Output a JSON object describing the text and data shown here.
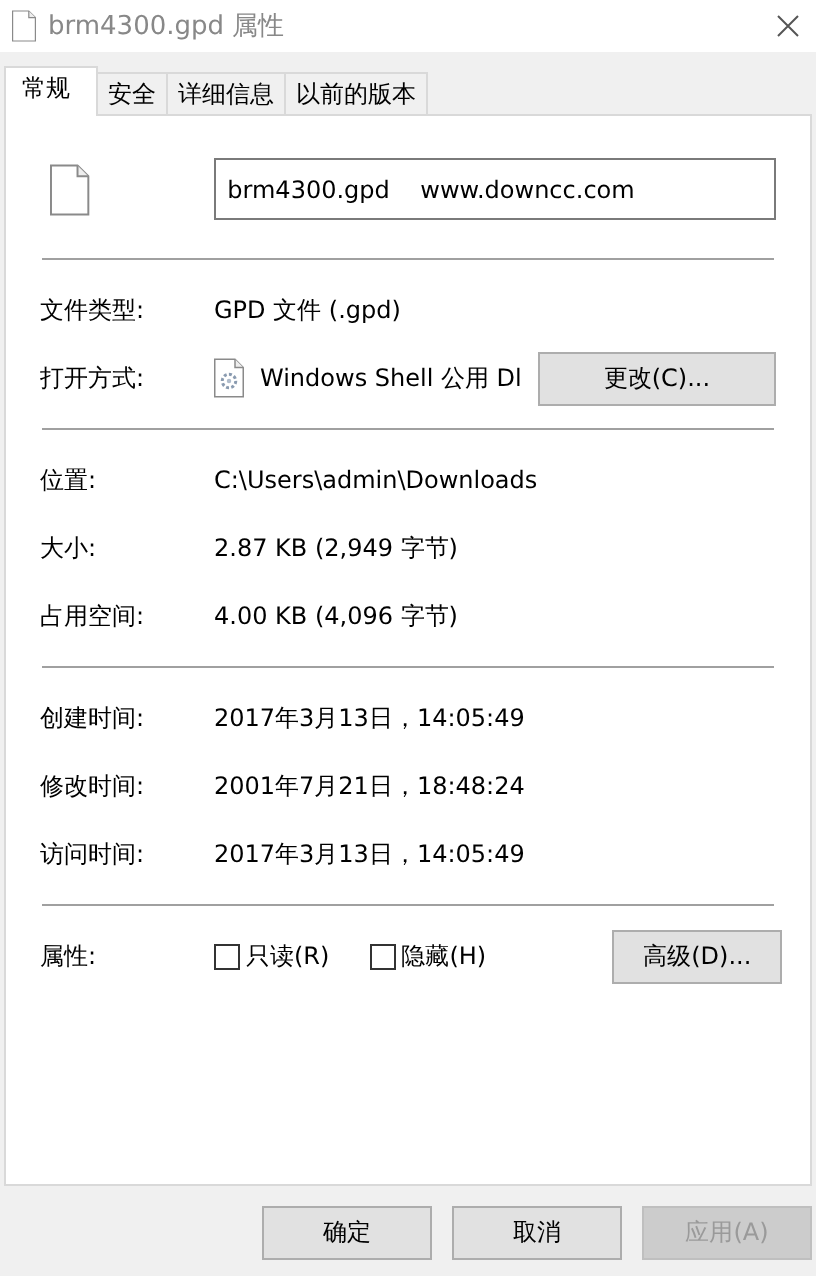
{
  "window": {
    "title": "brm4300.gpd 属性"
  },
  "tabs": [
    {
      "label": "常规",
      "selected": true
    },
    {
      "label": "安全",
      "selected": false
    },
    {
      "label": "详细信息",
      "selected": false
    },
    {
      "label": "以前的版本",
      "selected": false
    }
  ],
  "file_name": {
    "value": "brm4300.gpd    www.downcc.com"
  },
  "sections": [
    {
      "rows": [
        {
          "kind": "text",
          "label": "文件类型:",
          "value": "GPD 文件 (.gpd)"
        },
        {
          "kind": "app",
          "label": "打开方式:",
          "value": "Windows Shell 公用 Dl",
          "button": "更改(C)..."
        }
      ]
    },
    {
      "rows": [
        {
          "kind": "text",
          "label": "位置:",
          "value": "C:\\Users\\admin\\Downloads"
        },
        {
          "kind": "text",
          "label": "大小:",
          "value": "2.87 KB (2,949 字节)"
        },
        {
          "kind": "text",
          "label": "占用空间:",
          "value": "4.00 KB (4,096 字节)"
        }
      ]
    },
    {
      "rows": [
        {
          "kind": "text",
          "label": "创建时间:",
          "value": "2017年3月13日，14:05:49"
        },
        {
          "kind": "text",
          "label": "修改时间:",
          "value": "2001年7月21日，18:48:24"
        },
        {
          "kind": "text",
          "label": "访问时间:",
          "value": "2017年3月13日，14:05:49"
        }
      ]
    },
    {
      "rows": [
        {
          "kind": "attributes",
          "label": "属性:",
          "checkboxes": [
            {
              "label": "只读(R)",
              "checked": false
            },
            {
              "label": "隐藏(H)",
              "checked": false
            }
          ],
          "button": "高级(D)..."
        }
      ]
    }
  ],
  "buttons": [
    {
      "label": "确定",
      "disabled": false
    },
    {
      "label": "取消",
      "disabled": false
    },
    {
      "label": "应用(A)",
      "disabled": true
    }
  ]
}
